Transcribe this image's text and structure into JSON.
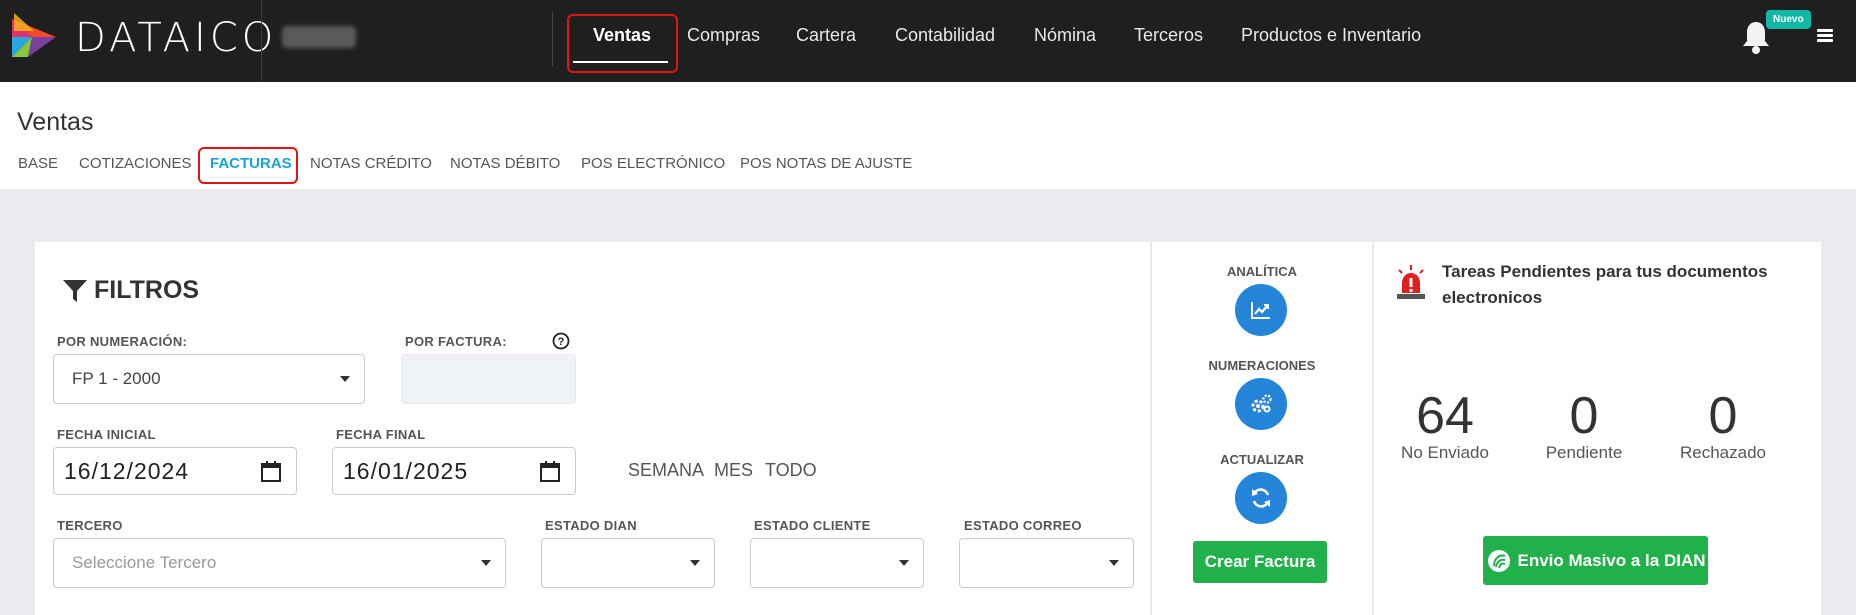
{
  "brand": {
    "name": "DATAICO"
  },
  "topnav": {
    "items": [
      "Ventas",
      "Compras",
      "Cartera",
      "Contabilidad",
      "Nómina",
      "Terceros",
      "Productos e Inventario"
    ],
    "active": "Ventas",
    "badge": "Nuevo"
  },
  "subheader": {
    "title": "Ventas",
    "tabs": [
      "BASE",
      "COTIZACIONES",
      "FACTURAS",
      "NOTAS CRÉDITO",
      "NOTAS DÉBITO",
      "POS ELECTRÓNICO",
      "POS NOTAS DE AJUSTE"
    ],
    "active_tab": "FACTURAS"
  },
  "filtros": {
    "title": "FILTROS",
    "por_numeracion": {
      "label": "POR NUMERACIÓN:",
      "value": "FP 1 - 2000"
    },
    "por_factura": {
      "label": "POR FACTURA:",
      "value": ""
    },
    "fecha_inicial": {
      "label": "FECHA INICIAL",
      "value": "16/12/2024"
    },
    "fecha_final": {
      "label": "FECHA FINAL",
      "value": "16/01/2025"
    },
    "quick": [
      "SEMANA",
      "MES",
      "TODO"
    ],
    "tercero": {
      "label": "TERCERO",
      "placeholder": "Seleccione Tercero"
    },
    "estado_dian": {
      "label": "ESTADO DIAN",
      "value": ""
    },
    "estado_cliente": {
      "label": "ESTADO CLIENTE",
      "value": ""
    },
    "estado_correo": {
      "label": "ESTADO CORREO",
      "value": ""
    }
  },
  "actions": {
    "analitica": "ANALÍTICA",
    "numeraciones": "NUMERACIONES",
    "actualizar": "ACTUALIZAR",
    "crear_factura": "Crear Factura"
  },
  "tareas": {
    "title": "Tareas Pendientes para tus documentos electronicos",
    "stats": [
      {
        "value": "64",
        "label": "No Enviado"
      },
      {
        "value": "0",
        "label": "Pendiente"
      },
      {
        "value": "0",
        "label": "Rechazado"
      }
    ],
    "envio_button": "Envio Masivo a la DIAN"
  },
  "colors": {
    "accent": "#1aa3d9",
    "highlight": "#e01515",
    "primary_button": "#2484d8",
    "success": "#21b14a",
    "topbar": "#1f1f1f"
  }
}
